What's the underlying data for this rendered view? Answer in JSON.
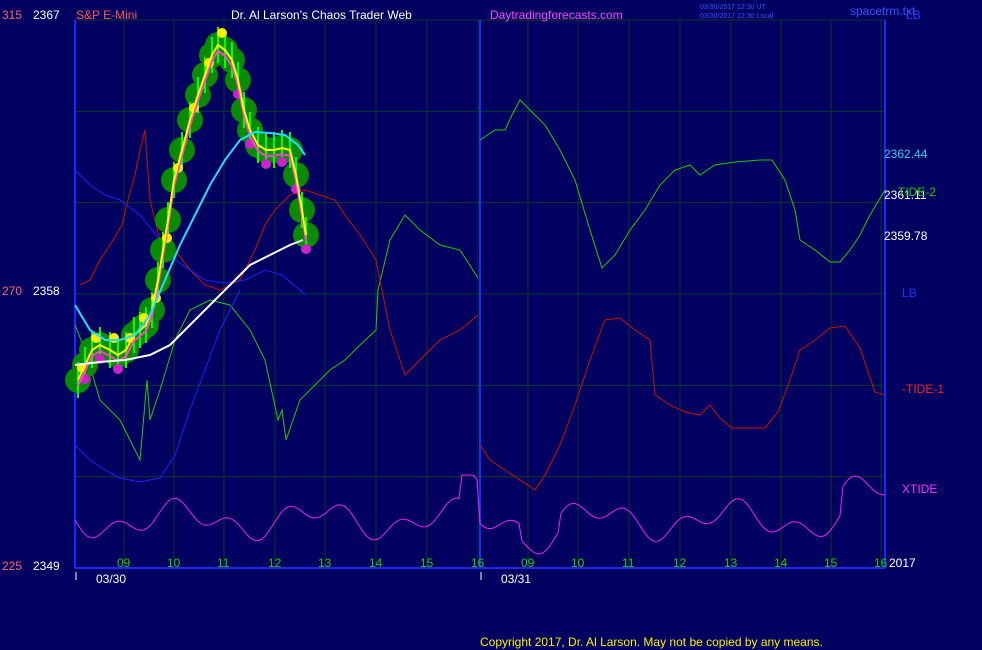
{
  "header": {
    "symbol": "S&P E-Mini",
    "site": "Dr. Al Larson's Chaos Trader Web",
    "url": "Daytradingforecasts.com",
    "stamp_line1": "03/30/2017 12:30 UT",
    "stamp_line2": "03/30/2017 12:30 Local",
    "brand": "spacetrm.txt"
  },
  "footer": {
    "copyright": "Copyright 2017, Dr. Al Larson. May not be copied by any means."
  },
  "colors": {
    "background": "#000060",
    "grid": "#0a3a2a",
    "axis": "#1a2aff",
    "tide1": "#cc1100",
    "tide2": "#22cc00",
    "xtide": "#ee22ee",
    "lb": "#1010dd",
    "price_fill": "#00cc00",
    "price_bar": "#00ff00",
    "dot_up": "#ffee00",
    "dot_down": "#cc22cc",
    "ma_fast": "#ffff00",
    "ma_cyan": "#22ddff",
    "ma_white": "#ffffff",
    "ma_magenta": "#ff44cc"
  },
  "chart_data": {
    "type": "line",
    "title": "S&P E-Mini",
    "y_left_outer": [
      "315",
      "270",
      "225"
    ],
    "y_left_price": [
      "2367",
      "2358",
      "2349"
    ],
    "ylim": [
      2349,
      2367
    ],
    "right_price_labels": [
      "2362.44",
      "2361.11",
      "2359.78"
    ],
    "dates": [
      "03/30",
      "03/31"
    ],
    "hour_ticks_day1": [
      "09",
      "10",
      "11",
      "12",
      "13",
      "14",
      "15",
      "16"
    ],
    "hour_ticks_day2": [
      "09",
      "10",
      "11",
      "12",
      "13",
      "14",
      "15",
      "16"
    ],
    "year_label": "2017",
    "series": [
      {
        "name": "TIDE-2",
        "color": "tide2",
        "label_text": "TIDE-2",
        "x": [
          0,
          4,
          6,
          7,
          8,
          9,
          10,
          12,
          14,
          16,
          18,
          20,
          22,
          24,
          26,
          28,
          30,
          32,
          34,
          36,
          38,
          40,
          42,
          44,
          46,
          48,
          50,
          52,
          54,
          56,
          58,
          60,
          62,
          64,
          66,
          68,
          70,
          72,
          74,
          76,
          78,
          80,
          82,
          84,
          86,
          88,
          90,
          92,
          94,
          96,
          98,
          100
        ],
        "values": [
          2358,
          2355,
          2352,
          2353,
          2354,
          2357,
          2356,
          2355,
          2355,
          2353,
          2356,
          2359,
          2360,
          2360,
          2360,
          2359,
          2359,
          2360,
          2362,
          2362,
          2363,
          2363,
          2362,
          2360,
          2360,
          2361,
          2361,
          2361,
          2360,
          2360,
          2360,
          2361,
          2362,
          2362,
          2362,
          2362,
          2362,
          2361,
          2361,
          2361,
          2360,
          2360,
          2360,
          2361,
          2361,
          2362,
          2362,
          2362,
          2361,
          2360,
          2361,
          2361
        ]
      },
      {
        "name": "TIDE-1",
        "color": "tide1",
        "label_text": "-TIDE-1",
        "x": [
          0,
          4,
          6,
          7,
          8,
          9,
          10,
          12,
          14,
          16,
          18,
          20,
          22,
          24,
          26,
          28,
          30,
          32,
          34,
          36,
          38,
          40,
          42,
          44,
          46,
          48,
          50,
          52,
          54,
          56,
          58,
          60,
          62,
          64,
          66,
          68,
          70,
          72,
          74,
          76,
          78,
          80,
          82,
          84,
          86,
          88,
          90,
          92,
          94,
          96,
          98,
          100
        ],
        "values": [
          2358,
          2361,
          2364,
          2362,
          2363,
          2361,
          2359,
          2357,
          2356,
          2359,
          2360,
          2361,
          2360,
          2360,
          2358,
          2356,
          2356,
          2355,
          2353,
          2354,
          2353,
          2352,
          2352,
          2354,
          2357,
          2358,
          2357,
          2355,
          2354,
          2354,
          2354,
          2355,
          2355,
          2356,
          2357,
          2357,
          2356,
          2356,
          2356,
          2356,
          2355,
          2355,
          2355,
          2355,
          2356,
          2357,
          2357,
          2357,
          2356,
          2355,
          2355,
          2355
        ]
      },
      {
        "name": "XTIDE",
        "color": "xtide",
        "label_text": "XTIDE"
      },
      {
        "name": "LB",
        "color": "lb",
        "label_text": "LB"
      }
    ]
  },
  "right_labels": {
    "lb_top": "LB"
  }
}
